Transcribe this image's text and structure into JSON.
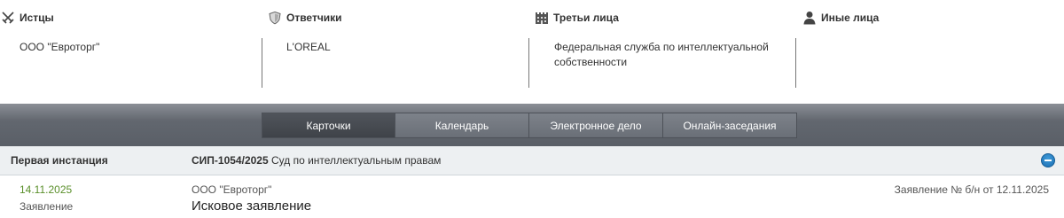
{
  "participants": {
    "plaintiffs": {
      "title": "Истцы",
      "icon": "crossed-swords-icon",
      "items": [
        "ООО \"Евроторг\""
      ]
    },
    "defendants": {
      "title": "Ответчики",
      "icon": "shield-icon",
      "items": [
        "L'OREAL"
      ]
    },
    "third_parties": {
      "title": "Третьи лица",
      "icon": "building-icon",
      "items": [
        "Федеральная служба по интеллектуальной собственности"
      ]
    },
    "others": {
      "title": "Иные лица",
      "icon": "person-icon",
      "items": [
        ""
      ]
    }
  },
  "tabs": [
    {
      "label": "Карточки",
      "active": true
    },
    {
      "label": "Календарь",
      "active": false
    },
    {
      "label": "Электронное дело",
      "active": false
    },
    {
      "label": "Онлайн-заседания",
      "active": false
    }
  ],
  "instance": {
    "title": "Первая инстанция",
    "case_number": "СИП-1054/2025",
    "court": "Суд по интеллектуальным правам",
    "collapse_icon": "minus-circle-icon"
  },
  "document": {
    "date": "14.11.2025",
    "type": "Заявление",
    "party": "ООО \"Евроторг\"",
    "title": "Исковое заявление",
    "note": "Заявление № б/н от 12.11.2025"
  },
  "colors": {
    "tabs_bar": "#62676f",
    "active_tab": "#45494f",
    "date_green": "#5a8f2a",
    "instance_bg": "#edf0f2",
    "collapse_blue": "#1b6fb3"
  }
}
